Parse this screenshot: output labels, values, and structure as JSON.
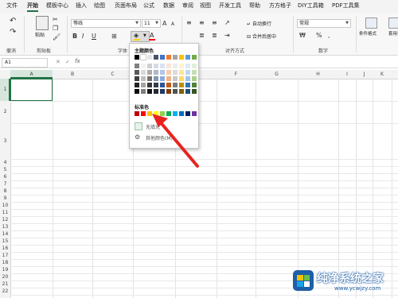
{
  "menu": [
    "文件",
    "开始",
    "模板中心",
    "插入",
    "绘图",
    "页面布局",
    "公式",
    "数据",
    "审阅",
    "视图",
    "开发工具",
    "帮助",
    "方方格子",
    "DIY工具箱",
    "PDF工具集"
  ],
  "ribbon": {
    "clipboard": {
      "paste": "粘贴",
      "undo_label": "撤消",
      "label": "剪贴板"
    },
    "font": {
      "name": "等线",
      "size": "11",
      "label": "字体",
      "bold": "B",
      "italic": "I",
      "underline": "U",
      "grow": "A",
      "shrink": "A",
      "font_color_letter": "A"
    },
    "alignment": {
      "wrap": "自动换行",
      "merge": "合并后居中",
      "label": "对齐方式"
    },
    "number": {
      "format": "常规",
      "label": "数字",
      "percent": "%",
      "comma": ",",
      "currency": "₩"
    },
    "styles": {
      "conditional": "条件格式",
      "table": "套用表格格式"
    }
  },
  "formula": {
    "cell_ref": "A1",
    "fx": "fx",
    "cancel": "✕",
    "confirm": "✓"
  },
  "columns": [
    "A",
    "B",
    "C",
    "D",
    "E",
    "F",
    "G",
    "H",
    "I",
    "J",
    "K",
    "L"
  ],
  "rows": [
    "1",
    "2",
    "3",
    "4",
    "5",
    "6",
    "7",
    "8",
    "9",
    "10",
    "11",
    "12",
    "13",
    "14",
    "15",
    "16",
    "17",
    "18",
    "19",
    "20",
    "21",
    "22"
  ],
  "dropdown": {
    "theme_title": "主题颜色",
    "standard_title": "标准色",
    "no_fill": "无填充",
    "more_colors": "其他颜色(M)...",
    "theme_top": [
      "#000000",
      "#ffffff",
      "#e7e6e6",
      "#44546a",
      "#4472c4",
      "#ed7d31",
      "#a5a5a5",
      "#ffc000",
      "#5b9bd5",
      "#70ad47"
    ],
    "theme_shades": [
      [
        "#7f7f7f",
        "#f2f2f2",
        "#d0cece",
        "#d6dce4",
        "#d9e2f3",
        "#fbe5d5",
        "#ededed",
        "#fff2cc",
        "#deebf6",
        "#e2efd9"
      ],
      [
        "#595959",
        "#d9d9d9",
        "#aeabab",
        "#adb9ca",
        "#b4c6e7",
        "#f7cbac",
        "#dbdbdb",
        "#fee599",
        "#bdd7ee",
        "#c5e0b3"
      ],
      [
        "#3f3f3f",
        "#bfbfbf",
        "#757070",
        "#8496b0",
        "#8eaadb",
        "#f4b183",
        "#c9c9c9",
        "#ffd965",
        "#9dc3e6",
        "#a8d08d"
      ],
      [
        "#262626",
        "#a5a5a5",
        "#3a3838",
        "#323f4f",
        "#2f5496",
        "#c55a11",
        "#7b7b7b",
        "#bf9000",
        "#2e75b5",
        "#538135"
      ],
      [
        "#0c0c0c",
        "#7f7f7f",
        "#171616",
        "#222a35",
        "#1f3864",
        "#833c0b",
        "#525252",
        "#7f6000",
        "#1e4e79",
        "#375623"
      ]
    ],
    "standard": [
      "#c00000",
      "#ff0000",
      "#ffc000",
      "#ffff00",
      "#92d050",
      "#00b050",
      "#00b0f0",
      "#0070c0",
      "#002060",
      "#7030a0"
    ]
  },
  "annotation": {
    "arrow_color": "#e8231f"
  },
  "watermark": {
    "brand": "纯净系统之家",
    "url": "www.ycwjzy.com"
  }
}
